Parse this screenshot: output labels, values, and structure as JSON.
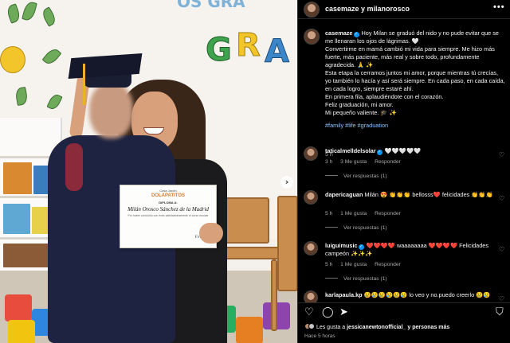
{
  "header": {
    "title": "casemaze y milanorosco",
    "more": "•••"
  },
  "photo": {
    "banner_letters": [
      "G",
      "R",
      "A"
    ],
    "top_letters": "OS GRA",
    "diploma": {
      "school": "Casa Jardín",
      "logo": "DOLAPATITOS",
      "type": "DIPLOMA A:",
      "name": "Milán Orosco Sánchez de la Madrid",
      "text": "Por haber concluido con éxito satisfactoriamente el curso escolar",
      "signature": "Firma"
    },
    "next": "›"
  },
  "caption": {
    "username": "casemaze",
    "verified": "✓",
    "lines": [
      "Hoy Milan se graduó del nido y no pude evitar que se me llenaran los ojos de lágrimas. 🤍",
      "Convertirme en mamá cambió mi vida para siempre. Me hizo más fuerte, más paciente, más real y sobre todo, profundamente agradecida. 🙏 ✨",
      "Esta etapa la cerramos juntos mi amor, porque mientras tú crecías, yo también lo hacía y así será siempre. En cada paso, en cada caída, en cada logro, siempre estaré ahí.",
      "En primera fila, aplaudiéndote con el corazón.",
      "Feliz graduación, mi amor.",
      "Mi pequeño valiente. 🎓 ✨"
    ],
    "hashtags": "#family #life #graduation",
    "time": "5 h"
  },
  "comments": [
    {
      "username": "taticalmelldelsolar",
      "verified": true,
      "text": "🤍🤍🤍🤍🤍",
      "time": "3 h",
      "likes": "3 Me gusta",
      "reply": "Responder",
      "replies": "Ver respuestas (1)"
    },
    {
      "username": "dapericaguan",
      "verified": false,
      "text": "Milán 😍 👏👏👏 bellosss❤️ felicidades 👏👏👏",
      "time": "5 h",
      "likes": "1 Me gusta",
      "reply": "Responder",
      "replies": "Ver respuestas (1)"
    },
    {
      "username": "luiguimusic",
      "verified": true,
      "text": "❤️❤️❤️❤️ waaaaaaaa ❤️❤️❤️❤️ Felicidades campeón ✨✨✨",
      "time": "5 h",
      "likes": "1 Me gusta",
      "reply": "Responder",
      "replies": "Ver respuestas (1)"
    },
    {
      "username": "karlapaula.kp",
      "verified": false,
      "text": "😢😢😢😢😢😢 lo veo y no.puedo creerlo 😢😢",
      "time": "",
      "likes": "",
      "reply": "",
      "replies": ""
    }
  ],
  "actions": {
    "like_icon": "heart-icon",
    "comment_icon": "comment-icon",
    "share_icon": "share-icon",
    "save_icon": "bookmark-icon",
    "likes_prefix": "Les gusta a",
    "likes_user": "jessicanewtonofficial_",
    "likes_suffix": "y personas más",
    "time": "Hace 5 horas"
  },
  "colors": {
    "background": "#000000",
    "link": "#8ec5ff",
    "verified": "#0095f6",
    "like_red": "#ff3040"
  }
}
